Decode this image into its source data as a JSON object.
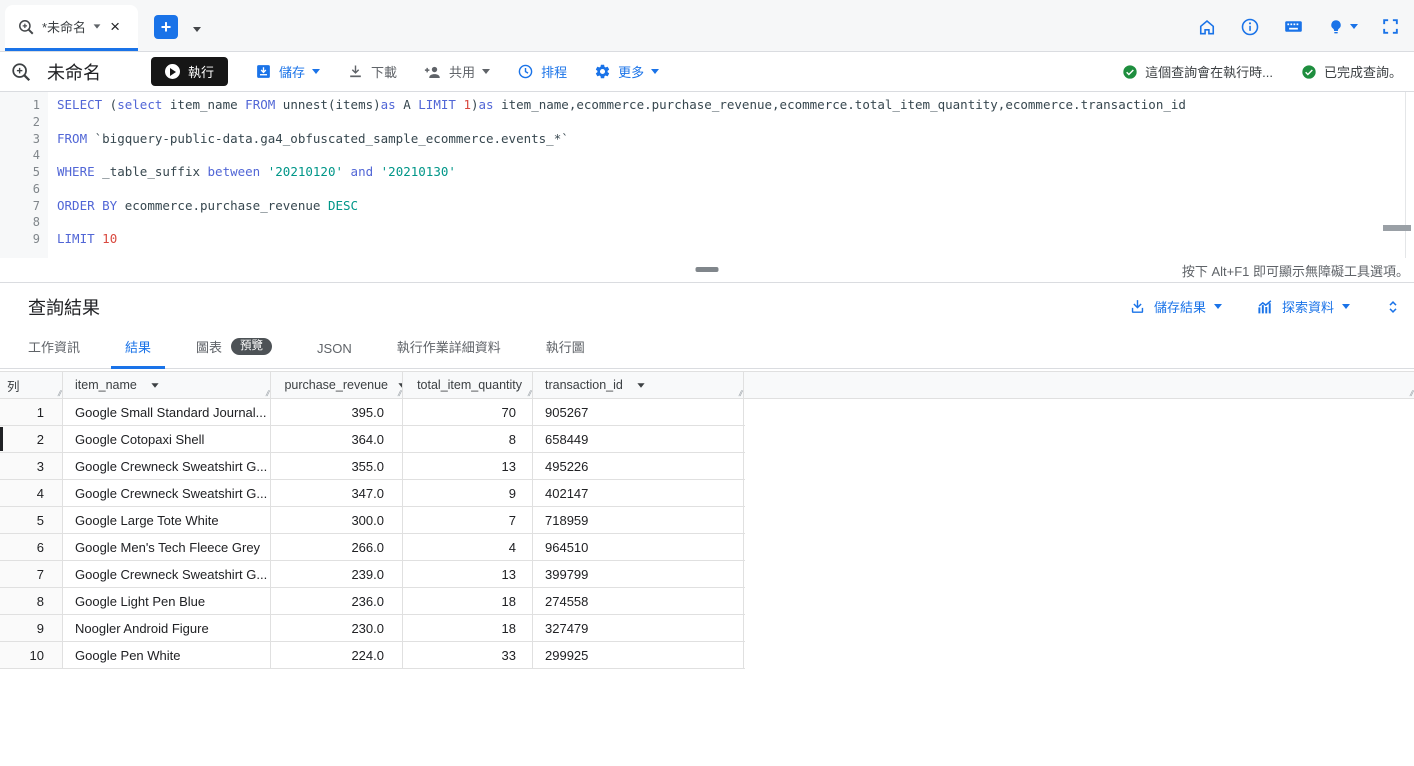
{
  "tab_strip": {
    "tab_title": "*未命名",
    "icons": {
      "logo": "bigquery-magnifier",
      "tab_menu": "caret-down",
      "close": "close-x",
      "add": "plus",
      "right": [
        "home",
        "info-circle",
        "keyboard",
        "lightbulb",
        "fullscreen"
      ]
    }
  },
  "toolbar": {
    "title": "未命名",
    "run": "執行",
    "save": "儲存",
    "download": "下載",
    "share": "共用",
    "schedule": "排程",
    "more": "更多",
    "status_messages": [
      {
        "icon": "check-circle",
        "text": "這個查詢會在執行時..."
      },
      {
        "icon": "check-circle",
        "text": "已完成查詢。"
      }
    ]
  },
  "editor": {
    "lines": [
      {
        "n": "1",
        "tokens": [
          [
            "k",
            "SELECT"
          ],
          [
            "t",
            " ("
          ],
          [
            "k",
            "select"
          ],
          [
            "t",
            " item_name "
          ],
          [
            "k",
            "FROM"
          ],
          [
            "t",
            " unnest(items)"
          ],
          [
            "k",
            "as"
          ],
          [
            "t",
            " A "
          ],
          [
            "k",
            "LIMIT"
          ],
          [
            "t",
            " "
          ],
          [
            "n",
            "1"
          ],
          [
            "t",
            ")"
          ],
          [
            "k",
            "as"
          ],
          [
            "t",
            " item_name,ecommerce.purchase_revenue,ecommerce.total_item_quantity,ecommerce.transaction_id"
          ]
        ]
      },
      {
        "n": "2",
        "tokens": []
      },
      {
        "n": "3",
        "tokens": [
          [
            "k",
            "FROM"
          ],
          [
            "t",
            " `bigquery-public-data.ga4_obfuscated_sample_ecommerce.events_*`"
          ]
        ]
      },
      {
        "n": "4",
        "tokens": []
      },
      {
        "n": "5",
        "tokens": [
          [
            "k",
            "WHERE"
          ],
          [
            "t",
            " _table_suffix "
          ],
          [
            "k",
            "between"
          ],
          [
            "t",
            " "
          ],
          [
            "s",
            "'20210120'"
          ],
          [
            "t",
            " "
          ],
          [
            "k",
            "and"
          ],
          [
            "t",
            " "
          ],
          [
            "s",
            "'20210130'"
          ]
        ]
      },
      {
        "n": "6",
        "tokens": []
      },
      {
        "n": "7",
        "tokens": [
          [
            "k",
            "ORDER BY"
          ],
          [
            "t",
            " ecommerce.purchase_revenue "
          ],
          [
            "d",
            "DESC"
          ]
        ]
      },
      {
        "n": "8",
        "tokens": []
      },
      {
        "n": "9",
        "tokens": [
          [
            "k",
            "LIMIT"
          ],
          [
            "t",
            " "
          ],
          [
            "n",
            "10"
          ]
        ]
      }
    ]
  },
  "hint": "按下 Alt+F1 即可顯示無障礙工具選項。",
  "results": {
    "title": "查詢結果",
    "save_results": "儲存結果",
    "explore_data": "探索資料",
    "tabs": [
      {
        "label": "工作資訊"
      },
      {
        "label": "結果",
        "active": true
      },
      {
        "label": "圖表",
        "badge": "預覽"
      },
      {
        "label": "JSON"
      },
      {
        "label": "執行作業詳細資料"
      },
      {
        "label": "執行圖"
      }
    ],
    "table": {
      "row_header": "列",
      "columns": [
        "item_name",
        "purchase_revenue",
        "total_item_quantity",
        "transaction_id"
      ],
      "rows": [
        [
          "1",
          "Google Small Standard Journal...",
          "395.0",
          "70",
          "905267"
        ],
        [
          "2",
          "Google Cotopaxi Shell",
          "364.0",
          "8",
          "658449"
        ],
        [
          "3",
          "Google Crewneck Sweatshirt G...",
          "355.0",
          "13",
          "495226"
        ],
        [
          "4",
          "Google Crewneck Sweatshirt G...",
          "347.0",
          "9",
          "402147"
        ],
        [
          "5",
          "Google Large Tote White",
          "300.0",
          "7",
          "718959"
        ],
        [
          "6",
          "Google Men's Tech Fleece Grey",
          "266.0",
          "4",
          "964510"
        ],
        [
          "7",
          "Google Crewneck Sweatshirt G...",
          "239.0",
          "13",
          "399799"
        ],
        [
          "8",
          "Google Light Pen Blue",
          "236.0",
          "18",
          "274558"
        ],
        [
          "9",
          "Noogler Android Figure",
          "230.0",
          "18",
          "327479"
        ],
        [
          "10",
          "Google Pen White",
          "224.0",
          "33",
          "299925"
        ]
      ]
    }
  },
  "colors": {
    "accent": "#1A73E8",
    "success": "#1E8E3E",
    "keyword": "#5166D6",
    "string_literal": "#009688",
    "number_literal": "#D9493F",
    "badge_bg": "#4D5256"
  }
}
